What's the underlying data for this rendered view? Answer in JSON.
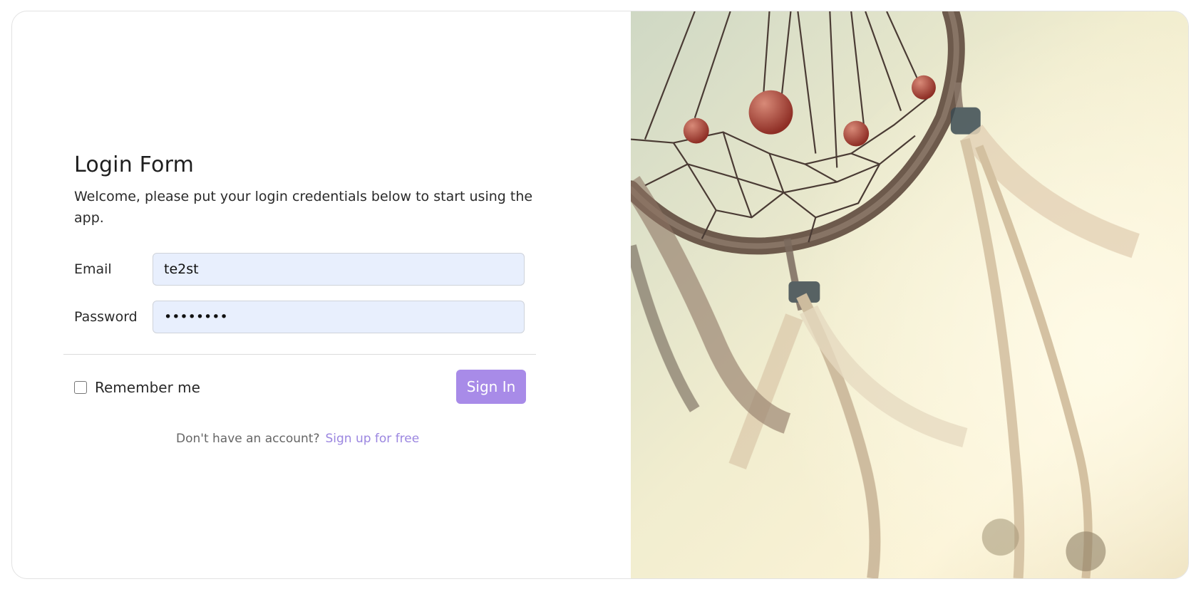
{
  "login": {
    "title": "Login Form",
    "subtitle": "Welcome, please put your login credentials below to start using the app.",
    "email": {
      "label": "Email",
      "value": "te2st"
    },
    "password": {
      "label": "Password",
      "value": "••••••••"
    },
    "remember_label": "Remember me",
    "remember_checked": false,
    "signin_label": "Sign In",
    "signup_prompt": "Don't have an account?",
    "signup_link": "Sign up for free"
  },
  "colors": {
    "accent": "#a88be8",
    "link": "#9b86e0",
    "input_bg": "#e8effd"
  },
  "image": {
    "subject": "dreamcatcher-photo"
  }
}
